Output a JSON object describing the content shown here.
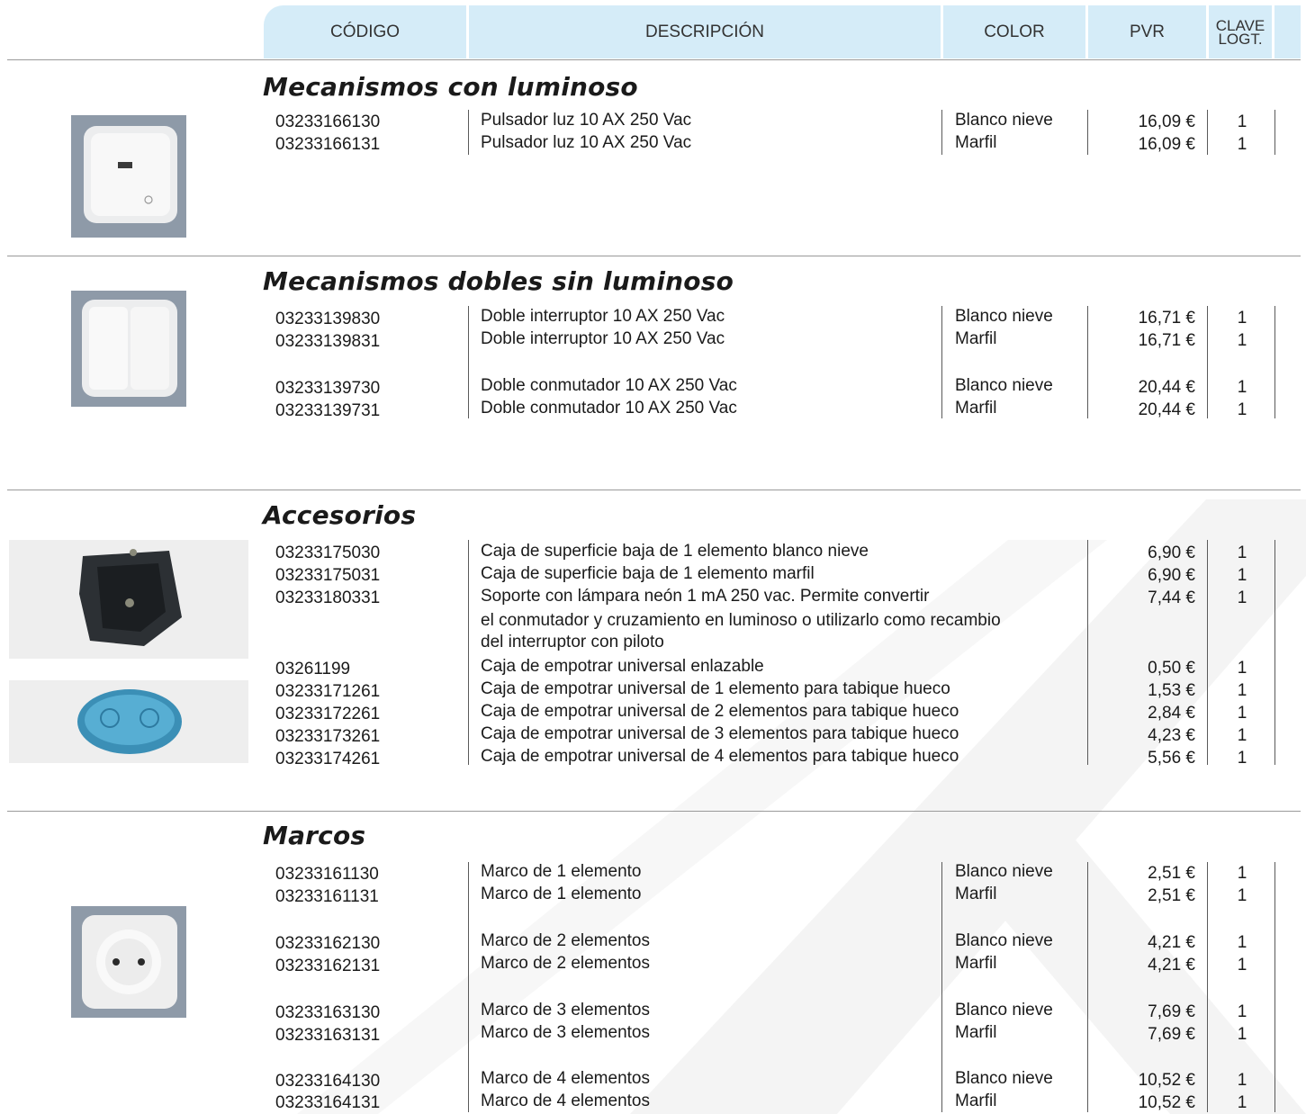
{
  "columns": {
    "codigo": "CÓDIGO",
    "descripcion": "DESCRIPCIÓN",
    "color": "COLOR",
    "pvr": "PVR",
    "clave_line1": "CLAVE",
    "clave_line2": "LOGT."
  },
  "sections": [
    {
      "title": "Mecanismos con luminoso",
      "image": "pulsador-luz-photo",
      "rows": [
        {
          "code": "03233166130",
          "desc": "Pulsador luz 10 AX 250 Vac",
          "color": "Blanco nieve",
          "price": "16,09 €",
          "clave": "1"
        },
        {
          "code": "03233166131",
          "desc": "Pulsador luz 10 AX 250 Vac",
          "color": "Marfil",
          "price": "16,09 €",
          "clave": "1"
        }
      ]
    },
    {
      "title": "Mecanismos dobles sin luminoso",
      "image": "doble-interruptor-photo",
      "rows": [
        {
          "code": "03233139830",
          "desc": "Doble interruptor 10 AX 250 Vac",
          "color": "Blanco nieve",
          "price": "16,71 €",
          "clave": "1"
        },
        {
          "code": "03233139831",
          "desc": "Doble interruptor 10 AX 250 Vac",
          "color": "Marfil",
          "price": "16,71 €",
          "clave": "1"
        },
        {
          "code": "03233139730",
          "desc": "Doble conmutador 10 AX 250 Vac",
          "color": "Blanco nieve",
          "price": "20,44 €",
          "clave": "1"
        },
        {
          "code": "03233139731",
          "desc": "Doble conmutador 10 AX 250 Vac",
          "color": "Marfil",
          "price": "20,44 €",
          "clave": "1"
        }
      ]
    },
    {
      "title": "Accesorios",
      "image": "caja-superficie-photo",
      "image2": "caja-empotrar-photo",
      "rows": [
        {
          "code": "03233175030",
          "desc": "Caja de superficie baja de 1 elemento blanco nieve",
          "color": "",
          "price": "6,90 €",
          "clave": "1"
        },
        {
          "code": "03233175031",
          "desc": "Caja de superficie baja de 1 elemento marfil",
          "color": "",
          "price": "6,90 €",
          "clave": "1"
        },
        {
          "code": "03233180331",
          "desc": "Soporte con lámpara neón 1 mA 250 vac. Permite convertir",
          "desc2": "el conmutador y cruzamiento en luminoso o utilizarlo como recambio",
          "desc3": "del interruptor con piloto",
          "color": "",
          "price": "7,44 €",
          "clave": "1"
        },
        {
          "code": "03261199",
          "desc": "Caja de empotrar universal enlazable",
          "color": "",
          "price": "0,50 €",
          "clave": "1"
        },
        {
          "code": "03233171261",
          "desc": "Caja de empotrar universal de 1 elemento para tabique hueco",
          "color": "",
          "price": "1,53 €",
          "clave": "1"
        },
        {
          "code": "03233172261",
          "desc": "Caja de empotrar universal de 2 elementos para tabique hueco",
          "color": "",
          "price": "2,84 €",
          "clave": "1"
        },
        {
          "code": "03233173261",
          "desc": "Caja de empotrar universal de 3 elementos para tabique hueco",
          "color": "",
          "price": "4,23 €",
          "clave": "1"
        },
        {
          "code": "03233174261",
          "desc": "Caja de empotrar universal de 4 elementos para tabique hueco",
          "color": "",
          "price": "5,56 €",
          "clave": "1"
        }
      ]
    },
    {
      "title": "Marcos",
      "image": "marco-enchufe-photo",
      "rows": [
        {
          "code": "03233161130",
          "desc": "Marco de 1 elemento",
          "color": "Blanco nieve",
          "price": "2,51 €",
          "clave": "1"
        },
        {
          "code": "03233161131",
          "desc": "Marco de 1 elemento",
          "color": "Marfil",
          "price": "2,51 €",
          "clave": "1"
        },
        {
          "code": "03233162130",
          "desc": "Marco de 2 elementos",
          "color": "Blanco nieve",
          "price": "4,21 €",
          "clave": "1"
        },
        {
          "code": "03233162131",
          "desc": "Marco de 2 elementos",
          "color": "Marfil",
          "price": "4,21 €",
          "clave": "1"
        },
        {
          "code": "03233163130",
          "desc": "Marco de 3 elementos",
          "color": "Blanco nieve",
          "price": "7,69 €",
          "clave": "1"
        },
        {
          "code": "03233163131",
          "desc": "Marco de 3 elementos",
          "color": "Marfil",
          "price": "7,69 €",
          "clave": "1"
        },
        {
          "code": "03233164130",
          "desc": "Marco de 4 elementos",
          "color": "Blanco nieve",
          "price": "10,52 €",
          "clave": "1"
        },
        {
          "code": "03233164131",
          "desc": "Marco de 4 elementos",
          "color": "Marfil",
          "price": "10,52 €",
          "clave": "1"
        }
      ]
    }
  ]
}
